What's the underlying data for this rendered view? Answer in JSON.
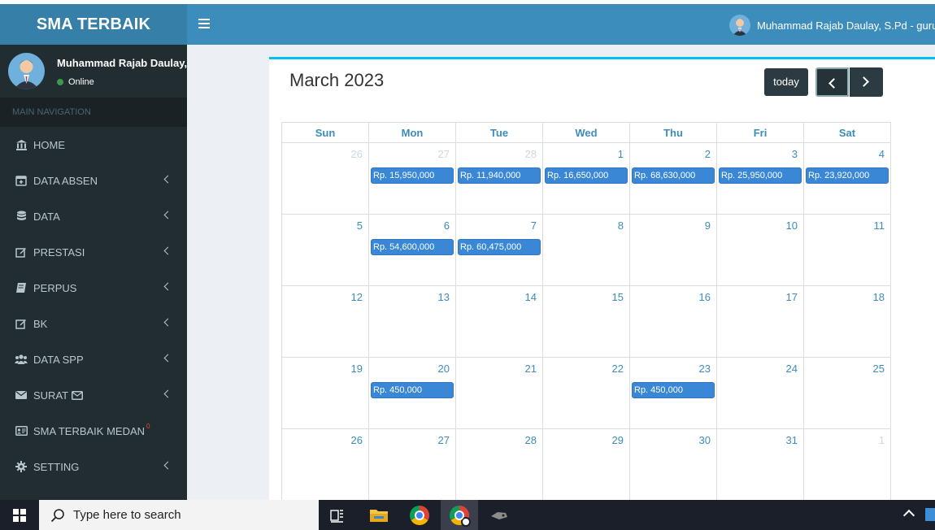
{
  "app": {
    "logo": "SMA TERBAIK",
    "navbar_user": "Muhammad Rajab Daulay, S.Pd - guru"
  },
  "sidebar": {
    "user_name": "Muhammad Rajab Daulay,",
    "status": "Online",
    "header": "MAIN NAVIGATION",
    "items": [
      {
        "label": "HOME",
        "icon": "bank-icon",
        "chevron": false
      },
      {
        "label": "DATA ABSEN",
        "icon": "calendar-plus-icon",
        "chevron": true
      },
      {
        "label": "DATA",
        "icon": "database-icon",
        "chevron": true
      },
      {
        "label": "PRESTASI",
        "icon": "edit-icon",
        "chevron": true
      },
      {
        "label": "PERPUS",
        "icon": "book-icon",
        "chevron": true
      },
      {
        "label": "BK",
        "icon": "edit-icon",
        "chevron": true
      },
      {
        "label": "DATA SPP",
        "icon": "users-icon",
        "chevron": true
      },
      {
        "label": "SURAT",
        "icon": "envelope-icon",
        "chevron": true
      },
      {
        "label": "SMA TERBAIK MEDAN",
        "icon": "id-card-icon",
        "chevron": false,
        "badge": "0"
      },
      {
        "label": "SETTING",
        "icon": "gear-icon",
        "chevron": true
      }
    ]
  },
  "calendar": {
    "title": "March 2023",
    "today_label": "today",
    "weekdays": [
      "Sun",
      "Mon",
      "Tue",
      "Wed",
      "Thu",
      "Fri",
      "Sat"
    ],
    "weeks": [
      [
        {
          "d": "26",
          "other": true
        },
        {
          "d": "27",
          "other": true,
          "event": "Rp. 15,950,000"
        },
        {
          "d": "28",
          "other": true,
          "event": "Rp. 11,940,000"
        },
        {
          "d": "1",
          "event": "Rp. 16,650,000"
        },
        {
          "d": "2",
          "event": "Rp. 68,630,000"
        },
        {
          "d": "3",
          "event": "Rp. 25,950,000"
        },
        {
          "d": "4",
          "event": "Rp. 23,920,000"
        }
      ],
      [
        {
          "d": "5"
        },
        {
          "d": "6",
          "event": "Rp. 54,600,000"
        },
        {
          "d": "7",
          "event": "Rp. 60,475,000"
        },
        {
          "d": "8"
        },
        {
          "d": "9"
        },
        {
          "d": "10"
        },
        {
          "d": "11"
        }
      ],
      [
        {
          "d": "12"
        },
        {
          "d": "13"
        },
        {
          "d": "14"
        },
        {
          "d": "15"
        },
        {
          "d": "16"
        },
        {
          "d": "17"
        },
        {
          "d": "18"
        }
      ],
      [
        {
          "d": "19"
        },
        {
          "d": "20",
          "event": "Rp. 450,000"
        },
        {
          "d": "21"
        },
        {
          "d": "22"
        },
        {
          "d": "23",
          "event": "Rp. 450,000"
        },
        {
          "d": "24"
        },
        {
          "d": "25"
        }
      ],
      [
        {
          "d": "26"
        },
        {
          "d": "27"
        },
        {
          "d": "28"
        },
        {
          "d": "29"
        },
        {
          "d": "30"
        },
        {
          "d": "31"
        },
        {
          "d": "1",
          "other": true
        }
      ]
    ]
  },
  "taskbar": {
    "search_placeholder": "Type here to search"
  },
  "colors": {
    "header_blue": "#3c8dbc",
    "logo_blue": "#367fa9",
    "sidebar_dark": "#222d32",
    "event_blue": "#3a87d6",
    "box_accent": "#00c0ef"
  }
}
